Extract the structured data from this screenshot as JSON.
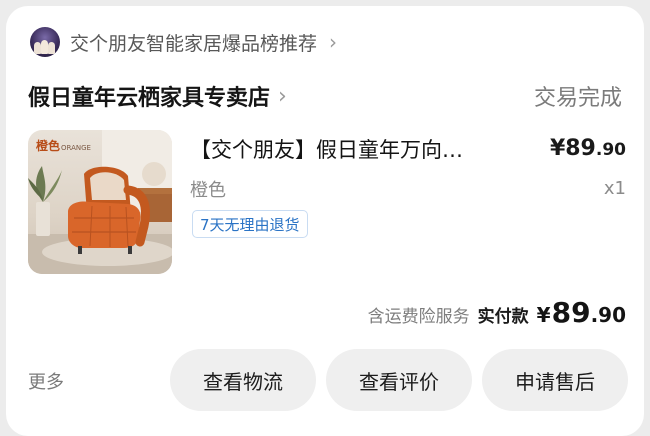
{
  "promo": {
    "text": "交个朋友智能家居爆品榜推荐",
    "chevron": "›"
  },
  "store": {
    "name": "假日童年云栖家具专卖店",
    "chevron": "›",
    "status": "交易完成"
  },
  "item": {
    "thumbnail_badge": "橙色",
    "thumbnail_badge_sub": "ORANGE",
    "title": "【交个朋友】假日童年万向…",
    "price_currency": "¥",
    "price_int": "89",
    "price_dec": ".90",
    "variant": "橙色",
    "quantity": "x1",
    "return_policy": "7天无理由退货"
  },
  "summary": {
    "service": "含运费险服务",
    "paid_label": "实付款",
    "currency": "¥",
    "total_int": "89",
    "total_dec": ".90"
  },
  "actions": {
    "more": "更多",
    "logistics": "查看物流",
    "review": "查看评价",
    "after_sales": "申请售后"
  },
  "colors": {
    "background": "#ececec",
    "card": "#ffffff",
    "button_bg": "#efefef",
    "tag_blue": "#2a73c5",
    "chair_orange": "#d9662a"
  }
}
